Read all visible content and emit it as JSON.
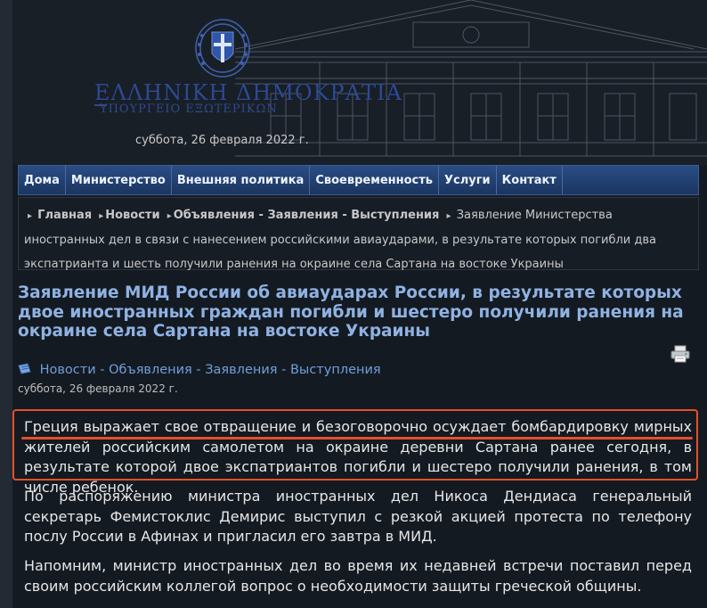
{
  "header": {
    "logo_title": "ΕΛΛΗΝΙΚΗ ΔΗΜΟΚΡΑΤΙΑ",
    "logo_subtitle": "ΥΠΟΥΡΓΕΙΟ ΕΞΩΤΕΡΙΚΩΝ",
    "date": "суббота, 26 февраля 2022 г."
  },
  "nav": {
    "items": [
      "Дома",
      "Министерство",
      "Внешняя политика",
      "Своевременность",
      "Услуги",
      "Контакт"
    ]
  },
  "breadcrumb": {
    "items": [
      "Главная",
      "Новости",
      "Объявления - Заявления - Выступления"
    ],
    "current": "Заявление Министерства иностранных дел в связи с нанесением российскими авиаударами, в результате которых погибли два экспатрианта и шесть получили ранения на окраине села Сартана на востоке Украины"
  },
  "article": {
    "title": "Заявление МИД России об авиаударах России, в результате которых двое иностранных граждан погибли и шестеро получили ранения на окраине села Сартана на востоке Украины",
    "category": "Новости - Объявления - Заявления - Выступления",
    "date": "суббота, 26 февраля 2022 г.",
    "paragraphs": [
      "Греция выражает свое отвращение и безоговорочно осуждает бомбардировку мирных жителей российским самолетом на окраине деревни Сартана ранее сегодня, в результате которой двое экспатриантов погибли и шестеро получили ранения, в том числе ребенок.",
      "По распоряжению министра иностранных дел Никоса Дендиаса генеральный секретарь Фемистоклис Демирис выступил с резкой акцией протеста по телефону послу России в Афинах и пригласил его завтра в МИД.",
      "Напомним, министр иностранных дел во время их недавней встречи поставил перед своим российским коллегой вопрос о необходимости защиты греческой общины."
    ]
  },
  "icons": {
    "emblem": "greek-coat-of-arms-icon",
    "category": "newspaper-icon",
    "print": "printer-icon",
    "breadcrumb_separator": "triangle-right-icon"
  },
  "colors": {
    "background": "#141a22",
    "nav": "#2a4d85",
    "title": "#8fb2e2",
    "link": "#6f9fdb",
    "highlight": "#e4502a"
  }
}
